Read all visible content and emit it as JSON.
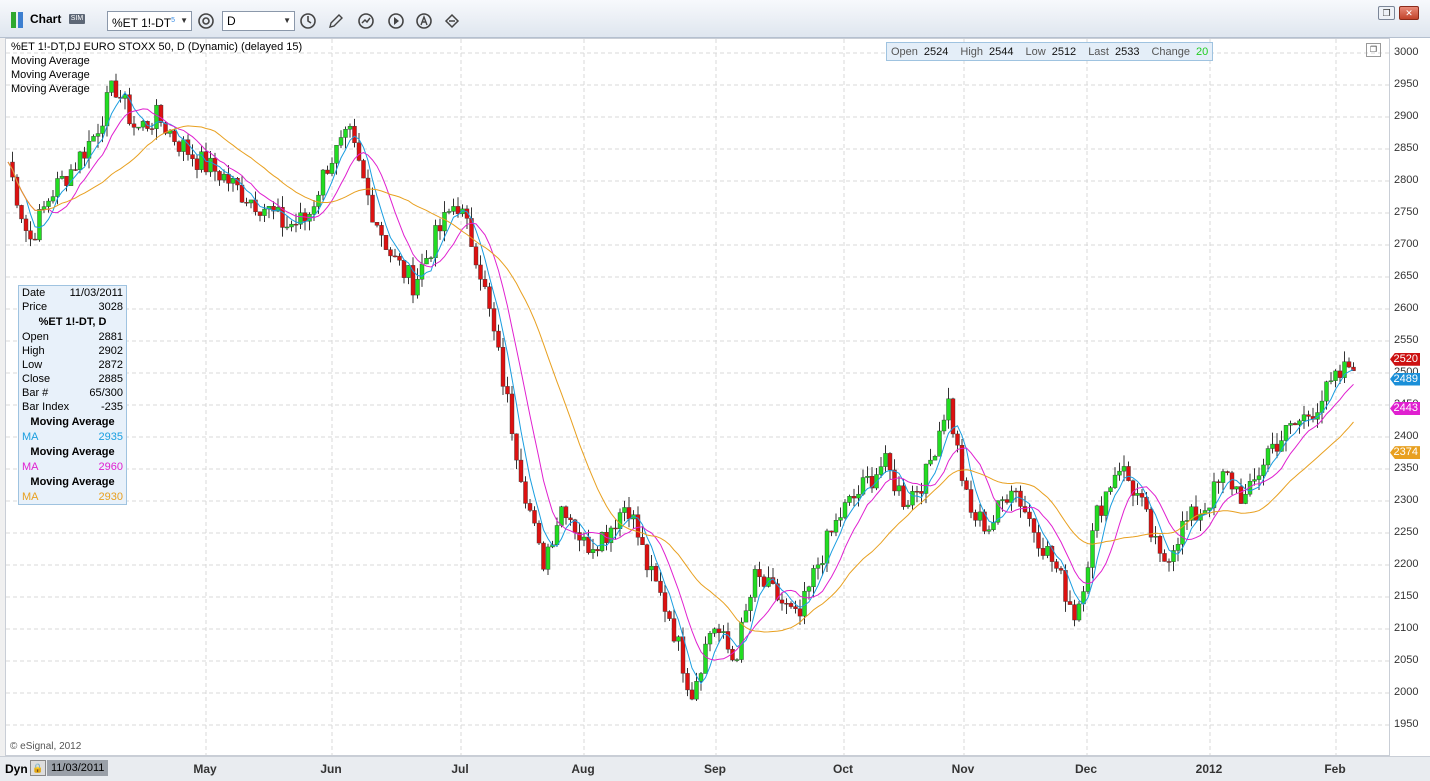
{
  "window": {
    "title": "Chart",
    "sim_badge": "SIM",
    "symbol_combo": {
      "value": "%ET 1!-DT",
      "superscript": "5"
    },
    "interval_combo": {
      "value": "D"
    }
  },
  "chart": {
    "symbol_line": "%ET 1!-DT,DJ EURO STOXX 50, D (Dynamic) (delayed 15)",
    "studies": [
      "Moving Average",
      "Moving Average",
      "Moving Average"
    ],
    "copyright": "© eSignal, 2012",
    "ohlc_bar": {
      "open_label": "Open",
      "open": "2524",
      "high_label": "High",
      "high": "2544",
      "low_label": "Low",
      "low": "2512",
      "last_label": "Last",
      "last": "2533",
      "change_label": "Change",
      "change": "20"
    },
    "data_window": {
      "date_label": "Date",
      "date": "11/03/2011",
      "price_label": "Price",
      "price": "3028",
      "symbol_header": "%ET 1!-DT, D",
      "open_label": "Open",
      "open": "2881",
      "high_label": "High",
      "high": "2902",
      "low_label": "Low",
      "low": "2872",
      "close_label": "Close",
      "close": "2885",
      "bar_label": "Bar #",
      "bar": "65/300",
      "bar_index_label": "Bar Index",
      "bar_index": "-235",
      "ma_sections": [
        {
          "header": "Moving Average",
          "label": "MA",
          "value": "2935",
          "color": "#1a9ee0"
        },
        {
          "header": "Moving Average",
          "label": "MA",
          "value": "2960",
          "color": "#e020d0"
        },
        {
          "header": "Moving Average",
          "label": "MA",
          "value": "2930",
          "color": "#e8a020"
        }
      ]
    },
    "price_tags": [
      {
        "value": "2520",
        "color": "#cc1111"
      },
      {
        "value": "2489",
        "color": "#1a8fd8"
      },
      {
        "value": "2443",
        "color": "#e020d0"
      },
      {
        "value": "2374",
        "color": "#e8a020"
      }
    ],
    "y_ticks": [
      "3000",
      "2950",
      "2900",
      "2850",
      "2800",
      "2750",
      "2700",
      "2650",
      "2600",
      "2550",
      "2500",
      "2450",
      "2400",
      "2350",
      "2300",
      "2250",
      "2200",
      "2150",
      "2100",
      "2050",
      "2000",
      "1950"
    ],
    "x_labels": [
      "May",
      "Jun",
      "Jul",
      "Aug",
      "Sep",
      "Oct",
      "Nov",
      "Dec",
      "2012",
      "Feb"
    ],
    "colors": {
      "up": "#22dd22",
      "down": "#dd1111",
      "ma_fast": "#1a9ee0",
      "ma_mid": "#e020d0",
      "ma_slow": "#e8a020",
      "grid": "#d8d8d8"
    }
  },
  "bottom_bar": {
    "mode": "Dyn",
    "cursor_date": "11/03/2011"
  },
  "chart_data": {
    "type": "candlestick",
    "title": "%ET 1!-DT,DJ EURO STOXX 50, D (Dynamic) (delayed 15)",
    "ylim": [
      1920,
      3030
    ],
    "anchors": [
      [
        "Apr",
        2830
      ],
      [
        "Apr",
        2705
      ],
      [
        "Apr",
        2780
      ],
      [
        "Apr",
        2820
      ],
      [
        "Apr-May",
        2870
      ],
      [
        "May",
        2950
      ],
      [
        "May",
        2880
      ],
      [
        "May",
        2900
      ],
      [
        "May",
        2860
      ],
      [
        "May",
        2830
      ],
      [
        "Jun",
        2810
      ],
      [
        "Jun",
        2780
      ],
      [
        "Jun",
        2760
      ],
      [
        "Jun",
        2730
      ],
      [
        "Jun",
        2740
      ],
      [
        "Jul",
        2830
      ],
      [
        "Jul",
        2870
      ],
      [
        "Jul",
        2760
      ],
      [
        "Jul",
        2680
      ],
      [
        "Jul",
        2640
      ],
      [
        "Jul",
        2710
      ],
      [
        "Jul-Aug",
        2770
      ],
      [
        "Aug",
        2680
      ],
      [
        "Aug",
        2520
      ],
      [
        "Aug",
        2350
      ],
      [
        "Aug",
        2200
      ],
      [
        "Aug",
        2300
      ],
      [
        "Aug",
        2230
      ],
      [
        "Aug-Sep",
        2250
      ],
      [
        "Sep",
        2300
      ],
      [
        "Sep",
        2190
      ],
      [
        "Sep",
        2120
      ],
      [
        "Sep",
        2000
      ],
      [
        "Sep",
        2110
      ],
      [
        "Sep",
        2050
      ],
      [
        "Sep",
        2180
      ],
      [
        "Sep",
        2150
      ],
      [
        "Oct",
        2110
      ],
      [
        "Oct",
        2210
      ],
      [
        "Oct",
        2280
      ],
      [
        "Oct",
        2320
      ],
      [
        "Oct",
        2360
      ],
      [
        "Oct",
        2300
      ],
      [
        "Oct",
        2340
      ],
      [
        "Oct-Nov",
        2460
      ],
      [
        "Nov",
        2280
      ],
      [
        "Nov",
        2260
      ],
      [
        "Nov",
        2330
      ],
      [
        "Nov",
        2260
      ],
      [
        "Nov",
        2200
      ],
      [
        "Nov",
        2120
      ],
      [
        "Nov-Dec",
        2280
      ],
      [
        "Dec",
        2360
      ],
      [
        "Dec",
        2300
      ],
      [
        "Dec",
        2200
      ],
      [
        "Dec",
        2260
      ],
      [
        "Dec",
        2290
      ],
      [
        "2012",
        2340
      ],
      [
        "2012",
        2300
      ],
      [
        "Jan",
        2380
      ],
      [
        "Jan",
        2410
      ],
      [
        "Jan",
        2440
      ],
      [
        "Feb",
        2480
      ],
      [
        "Feb",
        2520
      ]
    ],
    "last": {
      "open": 2524,
      "high": 2544,
      "low": 2512,
      "close": 2533,
      "change": 20
    },
    "moving_averages_last": [
      2489,
      2443,
      2374
    ]
  }
}
